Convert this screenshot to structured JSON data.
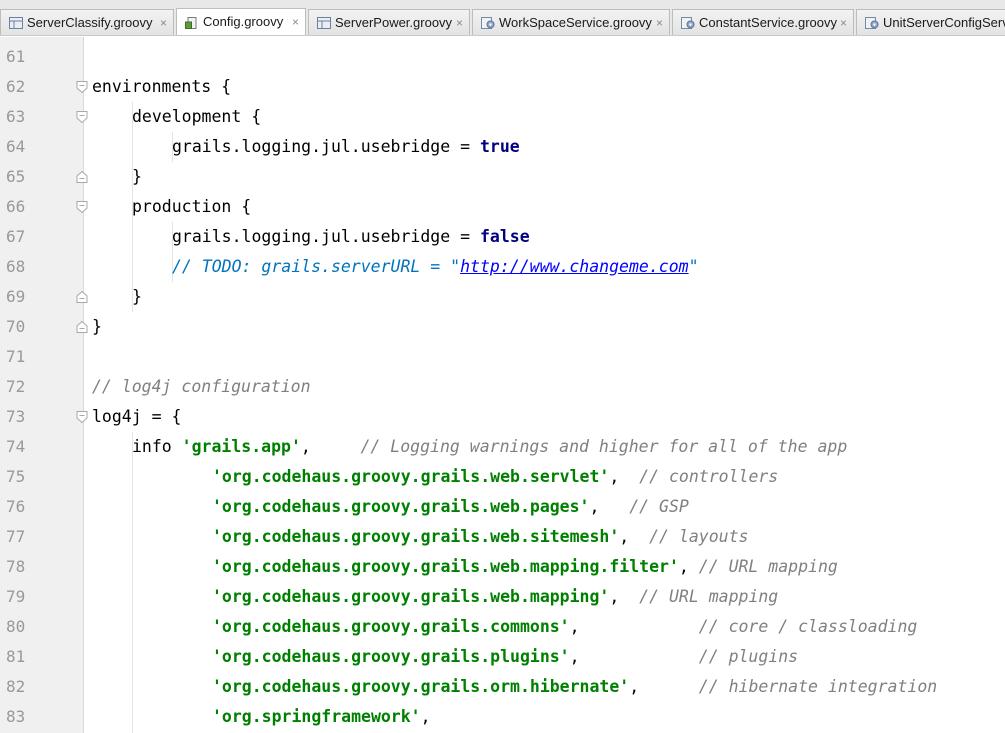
{
  "tabs": [
    {
      "label": "ServerClassify.groovy",
      "icon": "groovy-file-icon",
      "active": false,
      "close": "×"
    },
    {
      "label": "Config.groovy",
      "icon": "config-file-icon",
      "active": true,
      "close": "×"
    },
    {
      "label": "ServerPower.groovy",
      "icon": "groovy-file-icon",
      "active": false,
      "close": "×"
    },
    {
      "label": "WorkSpaceService.groovy",
      "icon": "service-file-icon",
      "active": false,
      "close": "×"
    },
    {
      "label": "ConstantService.groovy",
      "icon": "service-file-icon",
      "active": false,
      "close": "×"
    },
    {
      "label": "UnitServerConfigServi",
      "icon": "service-file-icon",
      "active": false,
      "close": ""
    }
  ],
  "editor": {
    "lines": [
      {
        "number": "61",
        "fold": "",
        "parts": []
      },
      {
        "number": "62",
        "fold": "open",
        "parts": [
          {
            "t": "plain",
            "text": "environments {"
          }
        ]
      },
      {
        "number": "63",
        "fold": "open",
        "parts": [
          {
            "t": "plain",
            "text": "development {"
          }
        ]
      },
      {
        "number": "64",
        "fold": "",
        "parts": [
          {
            "t": "plain",
            "text": "grails.logging.jul.usebridge = "
          },
          {
            "t": "kw",
            "text": "true"
          }
        ]
      },
      {
        "number": "65",
        "fold": "close",
        "parts": [
          {
            "t": "plain",
            "text": "}"
          }
        ]
      },
      {
        "number": "66",
        "fold": "open",
        "parts": [
          {
            "t": "plain",
            "text": "production {"
          }
        ]
      },
      {
        "number": "67",
        "fold": "",
        "parts": [
          {
            "t": "plain",
            "text": "grails.logging.jul.usebridge = "
          },
          {
            "t": "kw",
            "text": "false"
          }
        ]
      },
      {
        "number": "68",
        "fold": "",
        "parts": [
          {
            "t": "todo",
            "text": "// TODO: grails.serverURL = \""
          },
          {
            "t": "todo-link",
            "text": "http://www.changeme.com"
          },
          {
            "t": "todo",
            "text": "\""
          }
        ]
      },
      {
        "number": "69",
        "fold": "close",
        "parts": [
          {
            "t": "plain",
            "text": "}"
          }
        ]
      },
      {
        "number": "70",
        "fold": "close",
        "parts": [
          {
            "t": "plain",
            "text": "}"
          }
        ]
      },
      {
        "number": "71",
        "fold": "",
        "parts": []
      },
      {
        "number": "72",
        "fold": "",
        "parts": [
          {
            "t": "cmt",
            "text": "// log4j configuration"
          }
        ]
      },
      {
        "number": "73",
        "fold": "open",
        "parts": [
          {
            "t": "plain",
            "text": "log4j = {"
          }
        ]
      },
      {
        "number": "74",
        "fold": "",
        "parts": [
          {
            "t": "plain",
            "text": "info "
          },
          {
            "t": "str",
            "text": "'grails.app'"
          },
          {
            "t": "plain",
            "text": ",     "
          },
          {
            "t": "cmt",
            "text": "// Logging warnings and higher for all of the app"
          }
        ]
      },
      {
        "number": "75",
        "fold": "",
        "parts": [
          {
            "t": "str",
            "text": "'org.codehaus.groovy.grails.web.servlet'"
          },
          {
            "t": "plain",
            "text": ",  "
          },
          {
            "t": "cmt",
            "text": "// controllers"
          }
        ]
      },
      {
        "number": "76",
        "fold": "",
        "parts": [
          {
            "t": "str",
            "text": "'org.codehaus.groovy.grails.web.pages'"
          },
          {
            "t": "plain",
            "text": ",   "
          },
          {
            "t": "cmt",
            "text": "// GSP"
          }
        ]
      },
      {
        "number": "77",
        "fold": "",
        "parts": [
          {
            "t": "str",
            "text": "'org.codehaus.groovy.grails.web.sitemesh'"
          },
          {
            "t": "plain",
            "text": ",  "
          },
          {
            "t": "cmt",
            "text": "// layouts"
          }
        ]
      },
      {
        "number": "78",
        "fold": "",
        "parts": [
          {
            "t": "str",
            "text": "'org.codehaus.groovy.grails.web.mapping.filter'"
          },
          {
            "t": "plain",
            "text": ", "
          },
          {
            "t": "cmt",
            "text": "// URL mapping"
          }
        ]
      },
      {
        "number": "79",
        "fold": "",
        "parts": [
          {
            "t": "str",
            "text": "'org.codehaus.groovy.grails.web.mapping'"
          },
          {
            "t": "plain",
            "text": ",  "
          },
          {
            "t": "cmt",
            "text": "// URL mapping"
          }
        ]
      },
      {
        "number": "80",
        "fold": "",
        "parts": [
          {
            "t": "str",
            "text": "'org.codehaus.groovy.grails.commons'"
          },
          {
            "t": "plain",
            "text": ",            "
          },
          {
            "t": "cmt",
            "text": "// core / classloading"
          }
        ]
      },
      {
        "number": "81",
        "fold": "",
        "parts": [
          {
            "t": "str",
            "text": "'org.codehaus.groovy.grails.plugins'"
          },
          {
            "t": "plain",
            "text": ",            "
          },
          {
            "t": "cmt",
            "text": "// plugins"
          }
        ]
      },
      {
        "number": "82",
        "fold": "",
        "parts": [
          {
            "t": "str",
            "text": "'org.codehaus.groovy.grails.orm.hibernate'"
          },
          {
            "t": "plain",
            "text": ",      "
          },
          {
            "t": "cmt",
            "text": "// hibernate integration"
          }
        ]
      },
      {
        "number": "83",
        "fold": "",
        "parts": [
          {
            "t": "str",
            "text": "'org.springframework'"
          },
          {
            "t": "plain",
            "text": ","
          }
        ]
      }
    ]
  },
  "colors": {
    "keyword": "#000080",
    "string": "#008000",
    "comment": "#808080",
    "todo": "#0073bf",
    "gutter_bg": "#f0f0f0",
    "line_number": "#999999"
  }
}
